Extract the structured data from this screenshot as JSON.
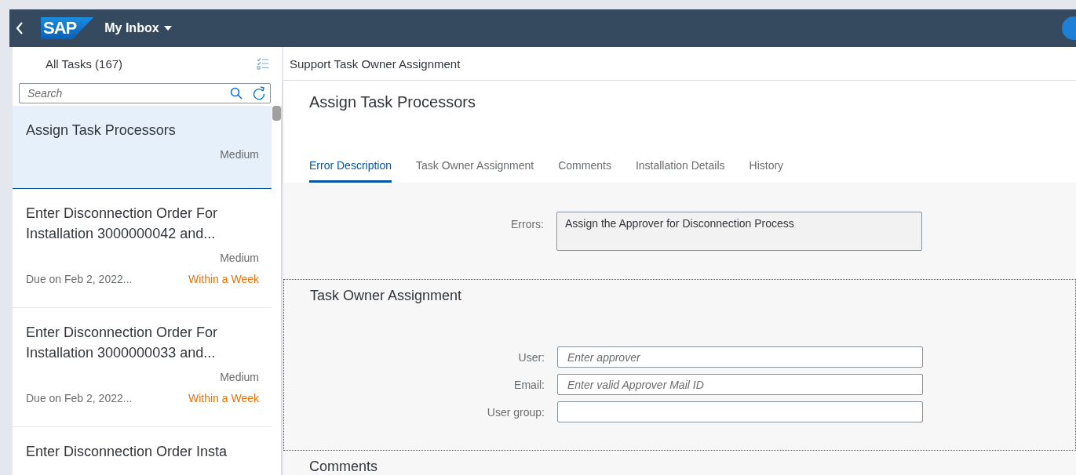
{
  "header": {
    "title": "My Inbox",
    "logo": "SAP"
  },
  "list": {
    "title": "All Tasks (167)",
    "search": {
      "placeholder": "Search"
    },
    "tasks": [
      {
        "title": "Assign Task Processors",
        "priority": "Medium",
        "selected": true
      },
      {
        "title": "Enter Disconnection Order For Installation 3000000042 and...",
        "priority": "Medium",
        "due": "Due on Feb 2, 2022...",
        "urgency": "Within a Week",
        "selected": false
      },
      {
        "title": "Enter Disconnection Order For Installation 3000000033 and...",
        "priority": "Medium",
        "due": "Due on Feb 2, 2022...",
        "urgency": "Within a Week",
        "selected": false
      },
      {
        "title": "Enter Disconnection Order Insta",
        "selected": false
      }
    ]
  },
  "detail": {
    "breadcrumb": "Support Task Owner Assignment",
    "title": "Assign Task Processors",
    "tabs": [
      {
        "label": "Error Description",
        "selected": true
      },
      {
        "label": "Task Owner Assignment",
        "selected": false
      },
      {
        "label": "Comments",
        "selected": false
      },
      {
        "label": "Installation Details",
        "selected": false
      },
      {
        "label": "History",
        "selected": false
      }
    ],
    "errors": {
      "label": "Errors:",
      "value": "Assign the Approver for Disconnection Process"
    },
    "owner_section": {
      "title": "Task Owner Assignment",
      "fields": [
        {
          "label": "User:",
          "placeholder": "Enter approver"
        },
        {
          "label": "Email:",
          "placeholder": "Enter valid Approver Mail ID"
        },
        {
          "label": "User group:"
        }
      ]
    },
    "comments_title": "Comments"
  }
}
